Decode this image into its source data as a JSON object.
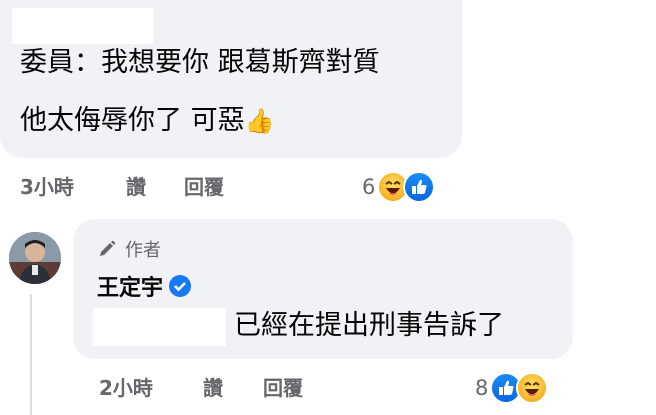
{
  "comment1": {
    "line1": "委員：我想要你 跟葛斯齊對質",
    "line2": "他太侮辱你了 可惡",
    "line2_emoji": "👍",
    "time": "3小時",
    "like": "讚",
    "reply": "回覆",
    "reaction_count": "6",
    "reactions": [
      "haha-icon",
      "like-icon"
    ]
  },
  "reply1": {
    "author_tag": "作者",
    "author_name": "王定宇",
    "text": "已經在提出刑事告訴了",
    "time": "2小時",
    "like": "讚",
    "reply": "回覆",
    "reaction_count": "8",
    "reactions": [
      "like-icon",
      "haha-icon"
    ]
  },
  "colors": {
    "bubble": "#f0f2f5",
    "meta_text": "#65676b",
    "verified": "#1877f2"
  }
}
